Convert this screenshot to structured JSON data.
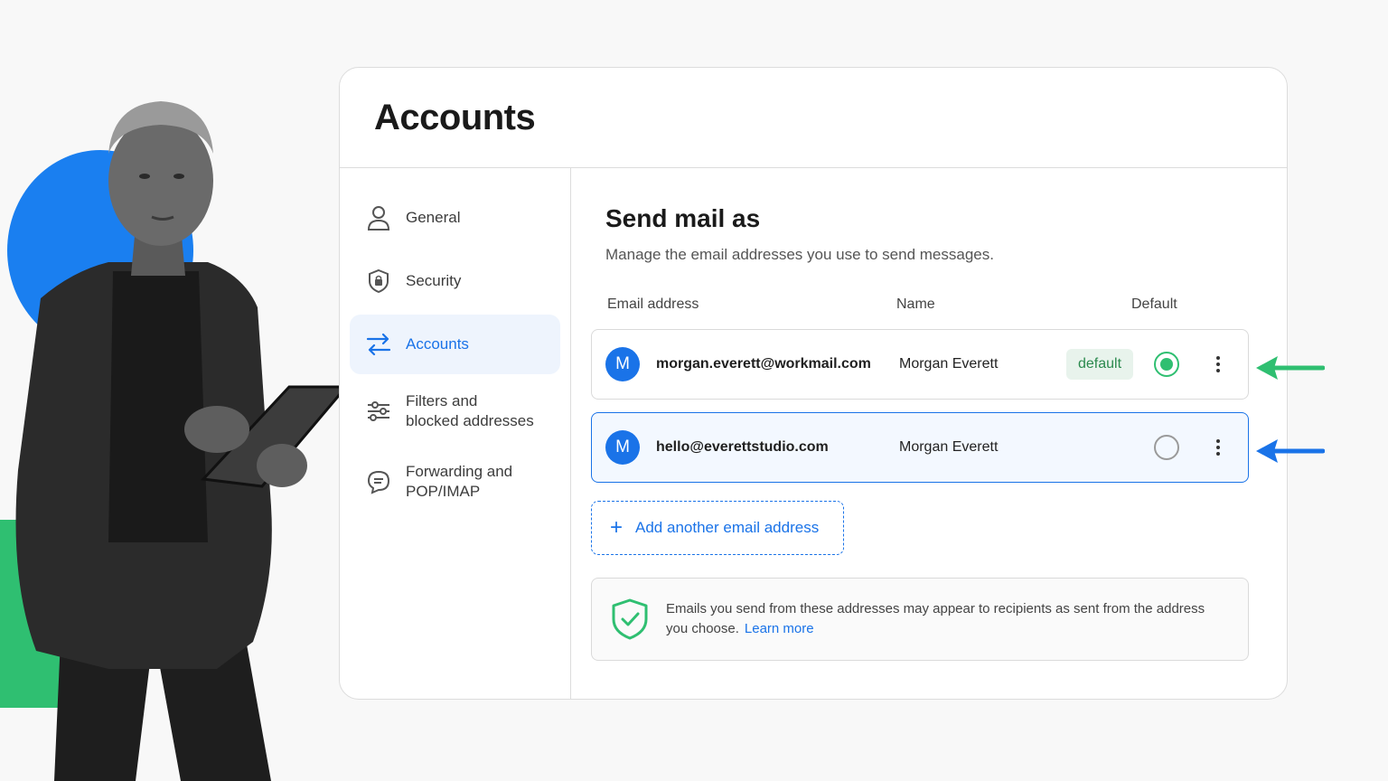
{
  "page": {
    "title": "Accounts"
  },
  "sidebar": {
    "items": [
      {
        "label": "General",
        "icon": "person-icon",
        "active": false
      },
      {
        "label": "Security",
        "icon": "shield-lock-icon",
        "active": false
      },
      {
        "label": "Accounts",
        "icon": "swap-arrows-icon",
        "active": true
      },
      {
        "label": "Filters and\nblocked addresses",
        "icon": "sliders-icon",
        "active": false
      },
      {
        "label": "Forwarding and\nPOP/IMAP",
        "icon": "chat-bubble-icon",
        "active": false
      }
    ]
  },
  "section": {
    "title": "Send mail as",
    "description": "Manage the email addresses you use to send messages.",
    "columns": {
      "email": "Email address",
      "name": "Name",
      "default": "Default"
    },
    "accounts": [
      {
        "avatar": "M",
        "email": "morgan.everett@workmail.com",
        "name": "Morgan Everett",
        "badge": "default",
        "is_default": true
      },
      {
        "avatar": "M",
        "email": "hello@everettstudio.com",
        "name": "Morgan Everett",
        "badge": "",
        "is_default": false
      }
    ],
    "add_label": "Add another email address",
    "notice": {
      "text": "Emails you send from these addresses may appear to recipients as sent from the address you choose.",
      "link": "Learn more"
    }
  },
  "colors": {
    "accent": "#1a73e8",
    "success": "#2fbf71",
    "blob_blue": "#1a7ff0",
    "blob_green": "#2fbf71"
  }
}
